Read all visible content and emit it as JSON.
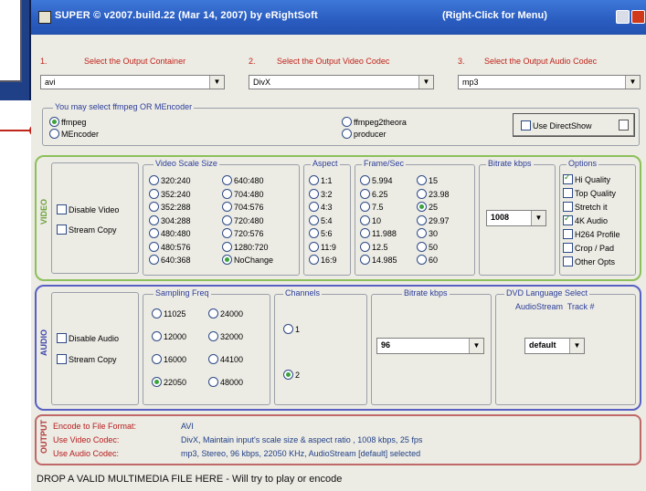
{
  "titlebar": {
    "title": "SUPER © v2007.build.22 (Mar 14, 2007) by eRightSoft",
    "right_hint": "(Right-Click for Menu)"
  },
  "selectors": [
    {
      "step": "1.",
      "label": "Select the Output Container",
      "value": "avi"
    },
    {
      "step": "2.",
      "label": "Select the Output Video Codec",
      "value": "DivX"
    },
    {
      "step": "3.",
      "label": "Select the Output Audio Codec",
      "value": "mp3"
    }
  ],
  "encoder": {
    "title": "You may select ffmpeg OR MEncoder",
    "options": [
      {
        "label": "ffmpeg",
        "selected": true
      },
      {
        "label": "MEncoder",
        "selected": false
      },
      {
        "label": "ffmpeg2theora",
        "selected": false
      },
      {
        "label": "producer",
        "selected": false
      }
    ],
    "directshow": {
      "label": "Use DirectShow",
      "checked": false
    }
  },
  "video": {
    "section_label": "VIDEO",
    "disable": "Disable Video",
    "stream_copy": "Stream Copy",
    "scale": {
      "title": "Video Scale Size",
      "options": [
        "320:240",
        "352:240",
        "352:288",
        "304:288",
        "480:480",
        "480:576",
        "640:368",
        "640:480",
        "704:480",
        "704:576",
        "720:480",
        "720:576",
        "1280:720",
        "NoChange"
      ],
      "selected": "NoChange"
    },
    "aspect": {
      "title": "Aspect",
      "options": [
        "1:1",
        "3:2",
        "4:3",
        "5:4",
        "5:6",
        "11:9",
        "16:9"
      ]
    },
    "fps": {
      "title": "Frame/Sec",
      "options": [
        "5.994",
        "6.25",
        "7.5",
        "10",
        "11.988",
        "12.5",
        "14.985",
        "15",
        "23.98",
        "25",
        "29.97",
        "30",
        "50",
        "60"
      ],
      "selected": "25"
    },
    "bitrate": {
      "title": "Bitrate  kbps",
      "value": "1008"
    },
    "options": {
      "title": "Options",
      "items": [
        {
          "label": "Hi Quality",
          "checked": true
        },
        {
          "label": "Top Quality",
          "checked": false
        },
        {
          "label": "Stretch it",
          "checked": false
        },
        {
          "label": "4K Audio",
          "checked": true
        },
        {
          "label": "H264 Profile",
          "checked": false
        },
        {
          "label": "Crop / Pad",
          "checked": false
        },
        {
          "label": "Other Opts",
          "checked": false
        }
      ]
    }
  },
  "audio": {
    "section_label": "AUDIO",
    "disable": "Disable Audio",
    "stream_copy": "Stream Copy",
    "sampling": {
      "title": "Sampling Freq",
      "options": [
        "11025",
        "12000",
        "16000",
        "22050",
        "24000",
        "32000",
        "44100",
        "48000"
      ],
      "selected": "22050"
    },
    "channels": {
      "title": "Channels",
      "options": [
        "1",
        "2"
      ],
      "selected": "2"
    },
    "bitrate": {
      "title": "Bitrate  kbps",
      "value": "96"
    },
    "dvd": {
      "title": "DVD Language Select",
      "subtitle": "AudioStream  Track #",
      "value": "default"
    }
  },
  "output": {
    "section_label": "OUTPUT",
    "lines": [
      {
        "key": "Encode to File Format:",
        "value": "AVI"
      },
      {
        "key": "Use Video Codec:",
        "value": "DivX,  Maintain input's scale size & aspect ratio ,  1008 kbps,  25 fps"
      },
      {
        "key": "Use Audio Codec:",
        "value": "mp3,  Stereo,  96 kbps,  22050 KHz,  AudioStream [default] selected"
      }
    ]
  },
  "status": "DROP A VALID MULTIMEDIA FILE HERE - Will try to play or encode"
}
